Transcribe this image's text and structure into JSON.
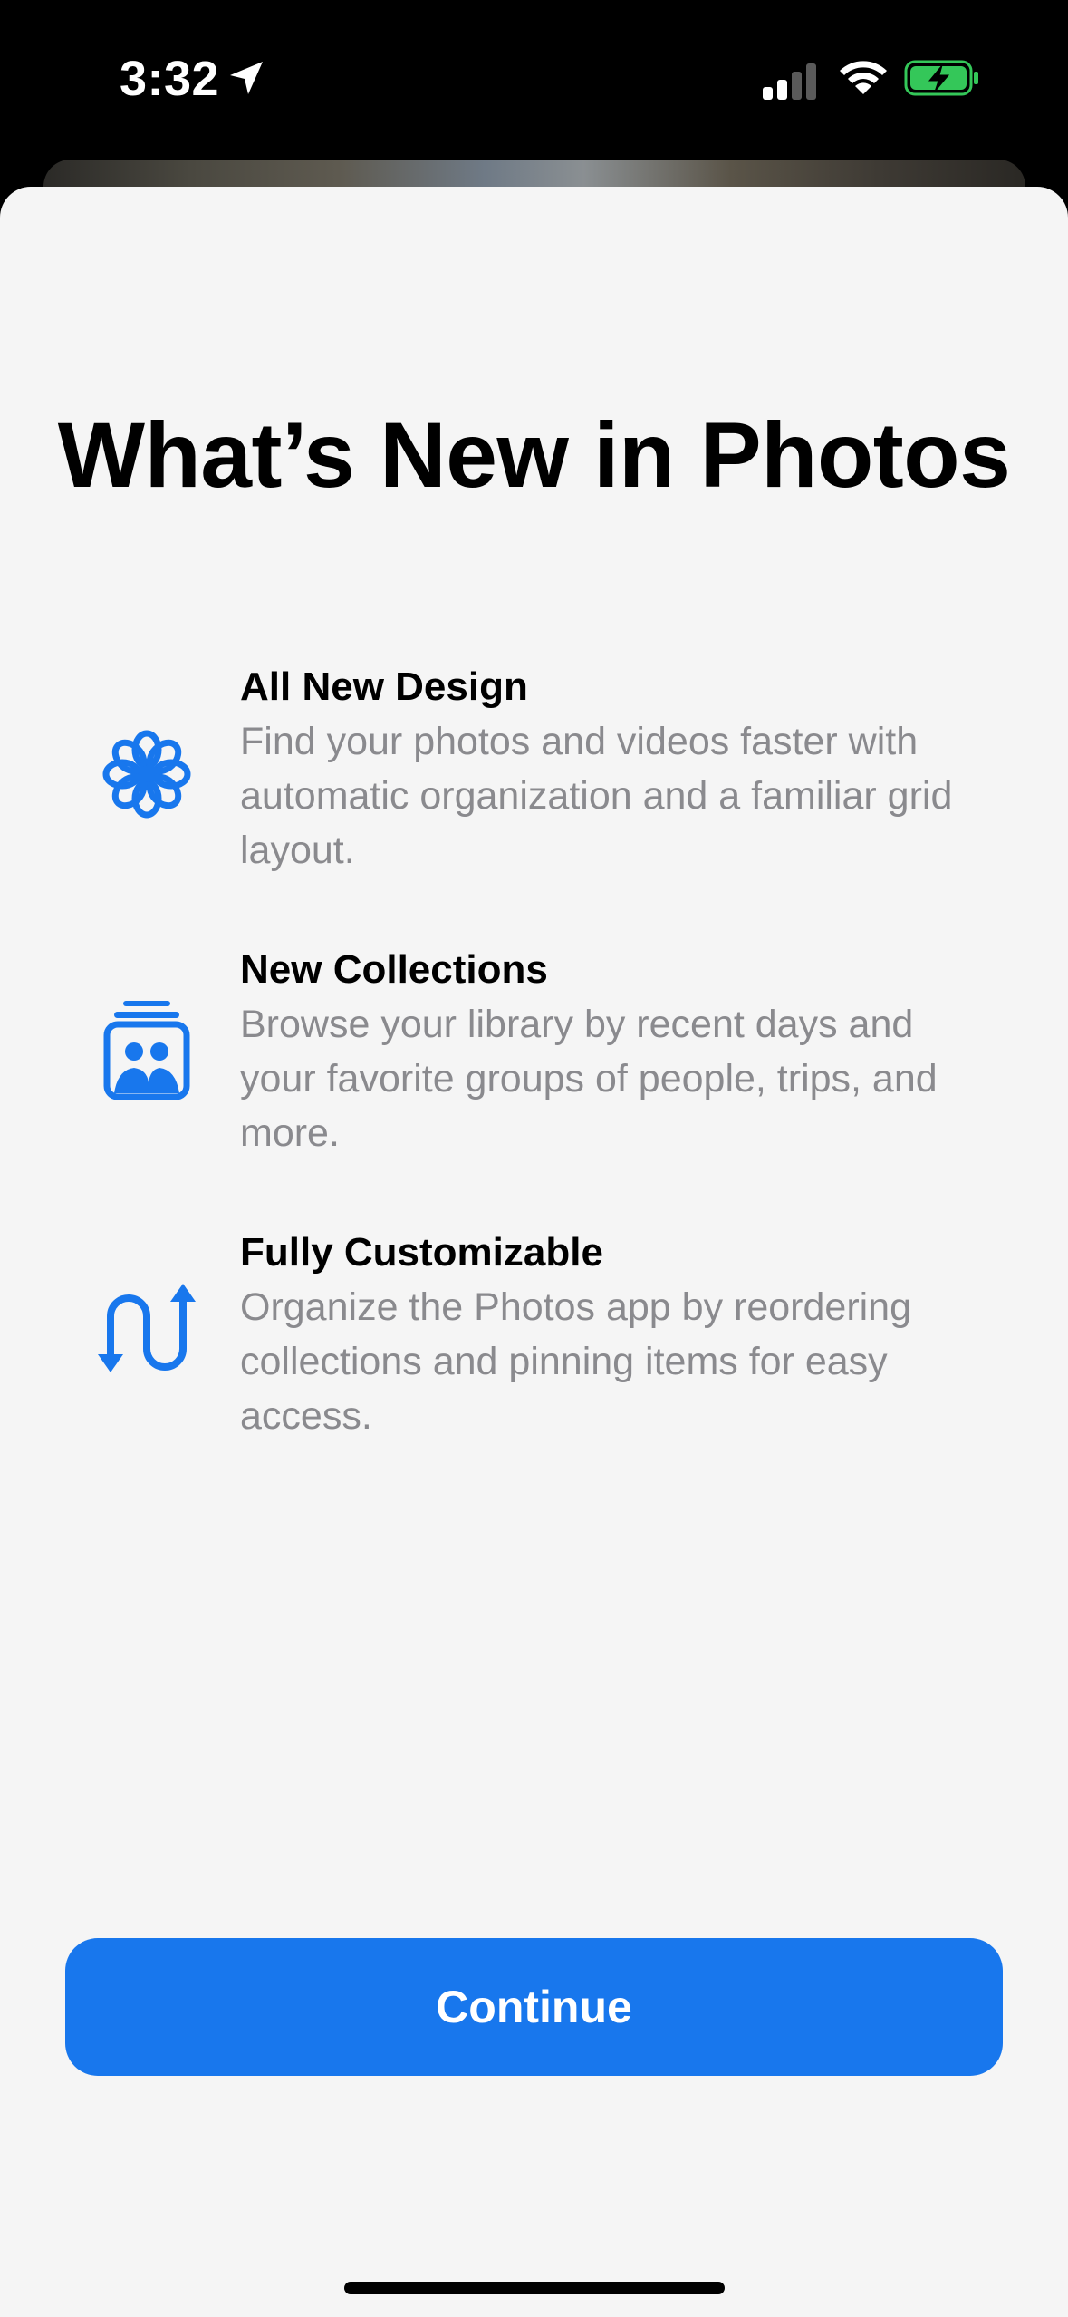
{
  "status_bar": {
    "time": "3:32",
    "icons": [
      "location-arrow-icon",
      "cellular-signal-icon",
      "wifi-icon",
      "battery-charging-icon"
    ],
    "battery_color": "#34c759"
  },
  "sheet": {
    "title": "What’s New in Photos",
    "features": [
      {
        "icon": "flower-icon",
        "title": "All New Design",
        "description": "Find your photos and videos faster with automatic organization and a familiar grid layout."
      },
      {
        "icon": "people-collection-icon",
        "title": "New Collections",
        "description": "Browse your library by recent days and your favorite groups of people, trips, and more."
      },
      {
        "icon": "reorder-arrows-icon",
        "title": "Fully Customizable",
        "description": "Organize the Photos app by reordering collections and pinning items for easy access."
      }
    ],
    "continue_label": "Continue"
  },
  "colors": {
    "accent": "#1877ed",
    "sheet_background": "#f5f5f5",
    "secondary_text": "#8a8a8e"
  }
}
